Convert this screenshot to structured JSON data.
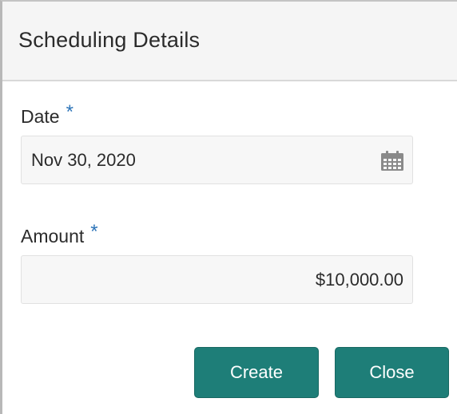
{
  "dialog": {
    "title": "Scheduling Details"
  },
  "form": {
    "date": {
      "label": "Date",
      "required_marker": "*",
      "value": "Nov 30, 2020",
      "icon": "calendar-icon"
    },
    "amount": {
      "label": "Amount",
      "required_marker": "*",
      "value": "$10,000.00"
    }
  },
  "buttons": {
    "create_label": "Create",
    "close_label": "Close"
  },
  "colors": {
    "accent_button": "#1e7e78",
    "required_marker": "#2d74b8",
    "header_background": "#f5f5f5",
    "input_background": "#f7f7f7"
  }
}
